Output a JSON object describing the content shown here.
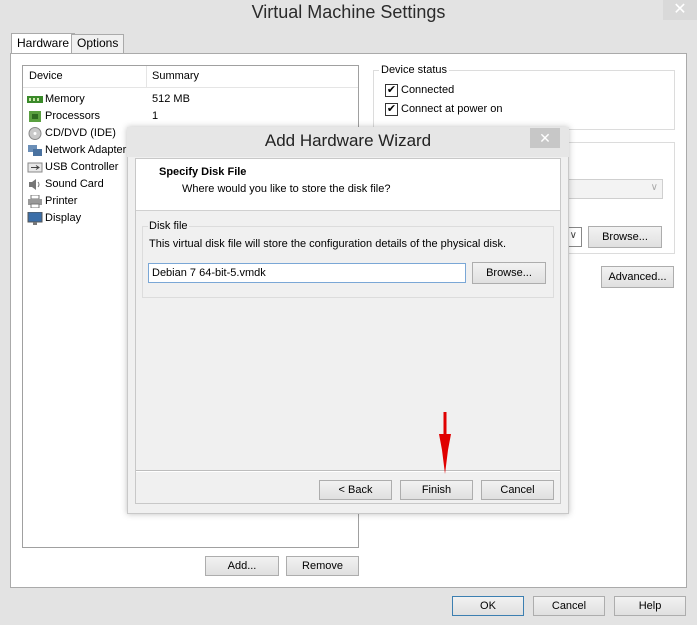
{
  "window": {
    "title": "Virtual Machine Settings",
    "close_glyph": "✕"
  },
  "tabs": [
    {
      "label": "Hardware",
      "active": true
    },
    {
      "label": "Options",
      "active": false
    }
  ],
  "device_list": {
    "headers": {
      "device": "Device",
      "summary": "Summary"
    },
    "rows": [
      {
        "name": "Memory",
        "summary": "512 MB",
        "icon": "memory-icon"
      },
      {
        "name": "Processors",
        "summary": "1",
        "icon": "processor-icon"
      },
      {
        "name": "CD/DVD (IDE)",
        "summary": "",
        "icon": "cd-dvd-icon"
      },
      {
        "name": "Network Adapter",
        "summary": "",
        "icon": "network-adapter-icon"
      },
      {
        "name": "USB Controller",
        "summary": "",
        "icon": "usb-icon"
      },
      {
        "name": "Sound Card",
        "summary": "",
        "icon": "sound-card-icon"
      },
      {
        "name": "Printer",
        "summary": "",
        "icon": "printer-icon"
      },
      {
        "name": "Display",
        "summary": "",
        "icon": "display-icon"
      }
    ],
    "add_label": "Add...",
    "remove_label": "Remove"
  },
  "device_status": {
    "label": "Device status",
    "connected_label": "Connected",
    "connected_checked": true,
    "connect_power_label": "Connect at power on",
    "connect_power_checked": true
  },
  "right_panel": {
    "browse_label": "Browse...",
    "advanced_label": "Advanced..."
  },
  "footer": {
    "ok_label": "OK",
    "cancel_label": "Cancel",
    "help_label": "Help"
  },
  "wizard": {
    "title": "Add Hardware Wizard",
    "close_glyph": "✕",
    "heading": "Specify Disk File",
    "subheading": "Where would you like to store the disk file?",
    "group_label": "Disk file",
    "description": "This virtual disk file will store the configuration details of the physical disk.",
    "file_value": "Debian 7 64-bit-5.vmdk",
    "browse_label": "Browse...",
    "back_label": "< Back",
    "finish_label": "Finish",
    "cancel_label": "Cancel"
  },
  "colors": {
    "annotation_arrow": "#e00000",
    "default_button_border": "#3c7fb1"
  }
}
